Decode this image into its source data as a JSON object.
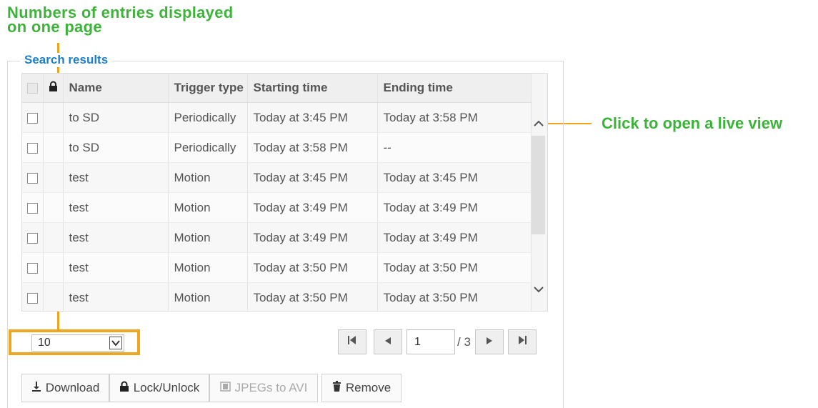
{
  "annotations": {
    "entries_line1": "Numbers of entries displayed",
    "entries_line2": "on one page",
    "live_view": "Click to open a live view",
    "color": "#3db33a",
    "callout_color": "#f0a51e"
  },
  "panel": {
    "legend": "Search results",
    "legend_color": "#1e7fc9"
  },
  "table": {
    "columns": [
      "Name",
      "Trigger type",
      "Starting time",
      "Ending time"
    ],
    "rows": [
      {
        "name": "to SD",
        "trigger": "Periodically",
        "start": "Today at 3:45 PM",
        "end": "Today at 3:58 PM"
      },
      {
        "name": "to SD",
        "trigger": "Periodically",
        "start": "Today at 3:58 PM",
        "end": "--"
      },
      {
        "name": "test",
        "trigger": "Motion",
        "start": "Today at 3:45 PM",
        "end": "Today at 3:45 PM"
      },
      {
        "name": "test",
        "trigger": "Motion",
        "start": "Today at 3:49 PM",
        "end": "Today at 3:49 PM"
      },
      {
        "name": "test",
        "trigger": "Motion",
        "start": "Today at 3:49 PM",
        "end": "Today at 3:49 PM"
      },
      {
        "name": "test",
        "trigger": "Motion",
        "start": "Today at 3:50 PM",
        "end": "Today at 3:50 PM"
      },
      {
        "name": "test",
        "trigger": "Motion",
        "start": "Today at 3:50 PM",
        "end": "Today at 3:50 PM"
      }
    ]
  },
  "pagination": {
    "per_page": "10",
    "current_page": "1",
    "total": "/ 3"
  },
  "actions": {
    "download": "Download",
    "lock_unlock": "Lock/Unlock",
    "jpegs_to_avi": "JPEGs to AVI",
    "remove": "Remove"
  },
  "icons": {
    "lock": "lock-icon",
    "download": "download-icon",
    "film": "film-icon",
    "trash": "trash-icon",
    "first": "first-page-icon",
    "prev": "prev-page-icon",
    "next": "next-page-icon",
    "last": "last-page-icon",
    "chevron_down": "chevron-down-icon",
    "scroll_up": "scroll-up-icon",
    "scroll_down": "scroll-down-icon"
  }
}
